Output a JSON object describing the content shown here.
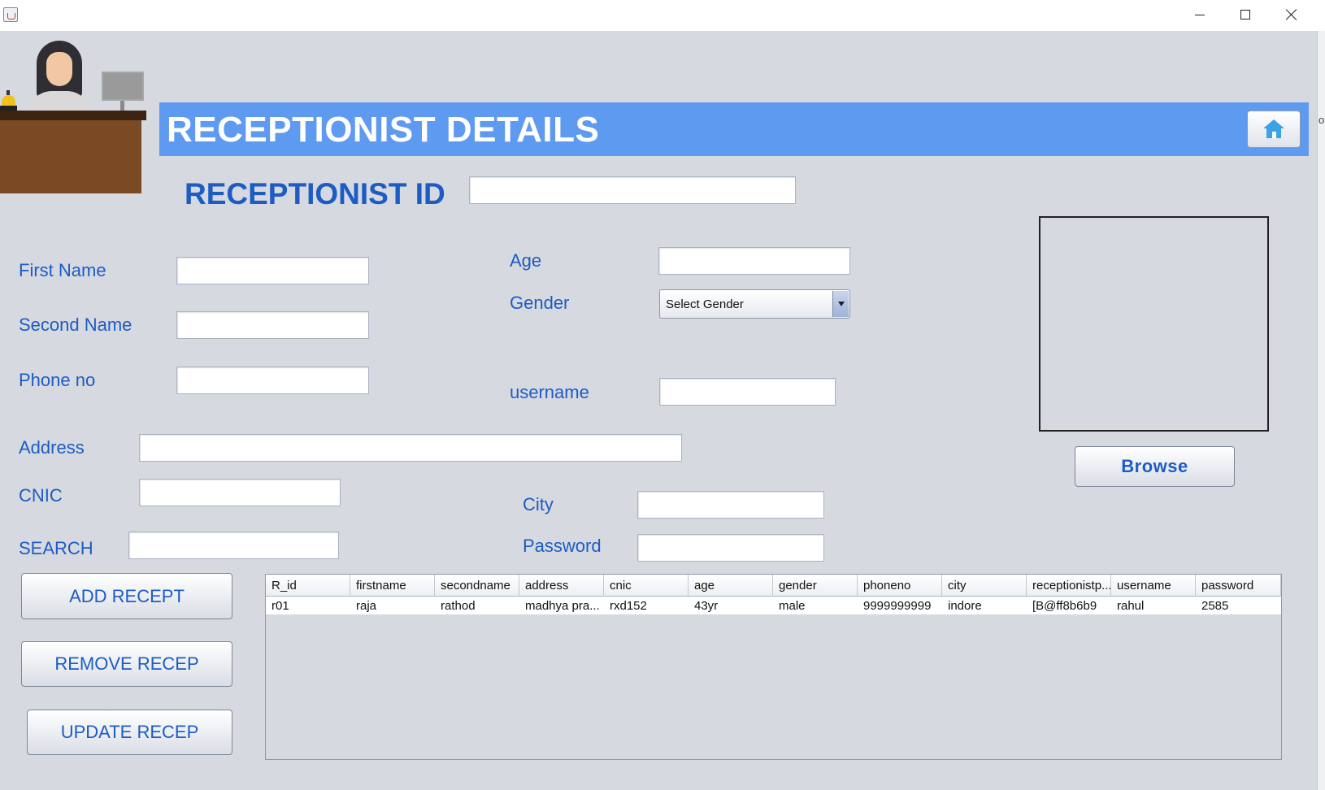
{
  "window": {
    "edge_text": "o"
  },
  "header": {
    "title": "RECEPTIONIST DETAILS"
  },
  "form": {
    "receptionist_id_label": "RECEPTIONIST ID",
    "receptionist_id_value": "",
    "first_name_label": "First Name",
    "first_name_value": "",
    "second_name_label": "Second Name",
    "second_name_value": "",
    "phone_label": "Phone no",
    "phone_value": "",
    "address_label": "Address",
    "address_value": "",
    "cnic_label": "CNIC",
    "cnic_value": "",
    "search_label": "SEARCH",
    "search_value": "",
    "age_label": "Age",
    "age_value": "",
    "gender_label": "Gender",
    "gender_selected": "Select Gender",
    "username_label": "username",
    "username_value": "",
    "city_label": "City",
    "city_value": "",
    "password_label": "Password",
    "password_value": ""
  },
  "buttons": {
    "browse": "Browse",
    "add": "ADD RECEPT",
    "remove": "REMOVE RECEP",
    "update": "UPDATE RECEP"
  },
  "table": {
    "columns": [
      "R_id",
      "firstname",
      "secondname",
      "address",
      "cnic",
      "age",
      "gender",
      "phoneno",
      "city",
      "receptionistp...",
      "username",
      "password"
    ],
    "rows": [
      [
        "r01",
        "raja",
        "rathod",
        "madhya pra...",
        "rxd152",
        "43yr",
        "male",
        "9999999999",
        "indore",
        "[B@ff8b6b9",
        "rahul",
        "2585"
      ]
    ]
  },
  "icons": {
    "app": "java-icon",
    "home": "home-icon"
  },
  "colors": {
    "banner": "#5e9af0",
    "label": "#1c5cc4",
    "background": "#d6d9e0"
  }
}
